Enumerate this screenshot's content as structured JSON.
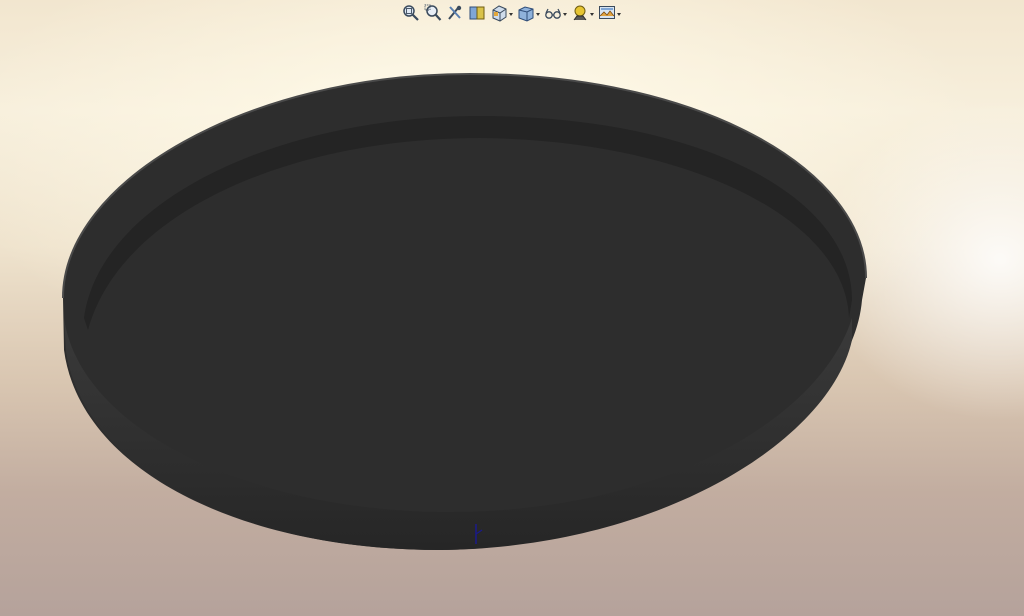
{
  "viewport": {
    "background_top": "#f2e6cf",
    "background_bottom": "#b5a29b",
    "model_color": "#2f2f2f",
    "model_edge_color": "#1a1a1a",
    "triad_color": "#1a1a8c"
  },
  "heads_up_toolbar": {
    "tools": [
      {
        "name": "zoom-to-fit-icon",
        "has_dropdown": false
      },
      {
        "name": "zoom-to-area-icon",
        "has_dropdown": false
      },
      {
        "name": "previous-view-icon",
        "has_dropdown": false
      },
      {
        "name": "section-view-icon",
        "has_dropdown": false
      },
      {
        "name": "view-orientation-icon",
        "has_dropdown": true
      },
      {
        "name": "display-style-icon",
        "has_dropdown": true
      },
      {
        "name": "hide-show-items-icon",
        "has_dropdown": true
      },
      {
        "name": "edit-appearance-icon",
        "has_dropdown": true
      },
      {
        "name": "apply-scene-icon",
        "has_dropdown": true
      }
    ]
  }
}
